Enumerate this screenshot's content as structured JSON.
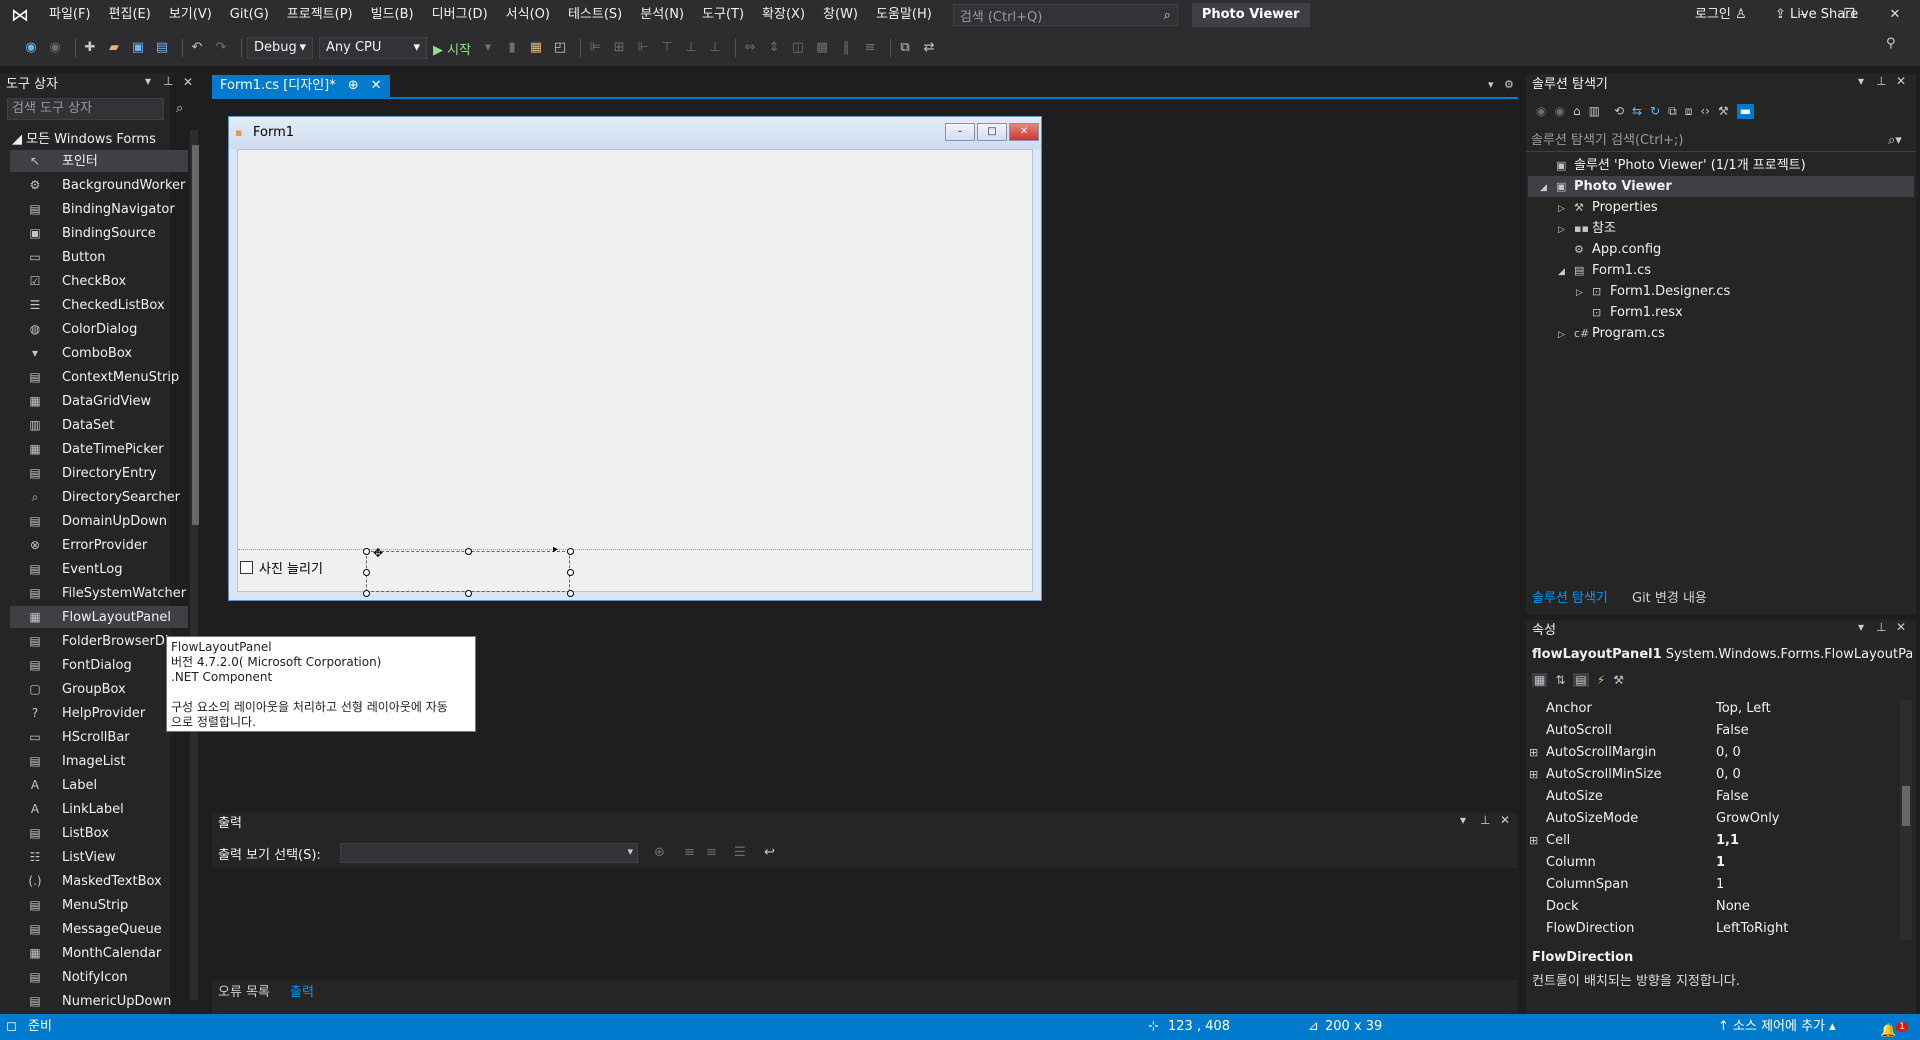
{
  "menu": [
    "파일(F)",
    "편집(E)",
    "보기(V)",
    "Git(G)",
    "프로젝트(P)",
    "빌드(B)",
    "디버그(D)",
    "서식(O)",
    "테스트(S)",
    "분석(N)",
    "도구(T)",
    "확장(X)",
    "창(W)",
    "도움말(H)"
  ],
  "search_placeholder": "검색 (Ctrl+Q)",
  "app_title": "Photo Viewer",
  "login": "로그인",
  "toolbar": {
    "config": "Debug",
    "platform": "Any CPU",
    "start": "▶ 시작",
    "live_share": "Live Share"
  },
  "toolbox": {
    "title": "도구 상자",
    "search": "검색 도구 상자",
    "group": "◢ 모든 Windows Forms",
    "items": [
      "포인터",
      "BackgroundWorker",
      "BindingNavigator",
      "BindingSource",
      "Button",
      "CheckBox",
      "CheckedListBox",
      "ColorDialog",
      "ComboBox",
      "ContextMenuStrip",
      "DataGridView",
      "DataSet",
      "DateTimePicker",
      "DirectoryEntry",
      "DirectorySearcher",
      "DomainUpDown",
      "ErrorProvider",
      "EventLog",
      "FileSystemWatcher",
      "FlowLayoutPanel",
      "FolderBrowserDi",
      "FontDialog",
      "GroupBox",
      "HelpProvider",
      "HScrollBar",
      "ImageList",
      "Label",
      "LinkLabel",
      "ListBox",
      "ListView",
      "MaskedTextBox",
      "MenuStrip",
      "MessageQueue",
      "MonthCalendar",
      "NotifyIcon",
      "NumericUpDown"
    ]
  },
  "doc_tab": {
    "label": "Form1.cs [디자인]*",
    "pin": "⊕",
    "close": "✕"
  },
  "form": {
    "title": "Form1",
    "checkbox_label": "사진 늘리기"
  },
  "tooltip": {
    "line1": "FlowLayoutPanel",
    "line2": "버전 4.7.2.0( Microsoft Corporation)",
    "line3": ".NET Component",
    "line4": "구성 요소의 레이아웃을 처리하고 선형 레이아웃에 자동",
    "line5": "으로 정렬합니다."
  },
  "output": {
    "title": "출력",
    "label": "출력 보기 선택(S):",
    "tabs": [
      "오류 목록",
      "출력"
    ]
  },
  "solution_explorer": {
    "title": "솔루션 탐색기",
    "search": "솔루션 탐색기 검색(Ctrl+;)",
    "nodes": [
      "솔루션 'Photo Viewer' (1/1개 프로젝트)",
      "Photo Viewer",
      "Properties",
      "참조",
      "App.config",
      "Form1.cs",
      "Form1.Designer.cs",
      "Form1.resx",
      "Program.cs"
    ],
    "tabs": [
      "솔루션 탐색기",
      "Git 변경 내용"
    ]
  },
  "properties": {
    "title": "속성",
    "object_name": "flowLayoutPanel1",
    "object_type": "System.Windows.Forms.FlowLayoutPan",
    "rows": [
      {
        "name": "Anchor",
        "value": "Top, Left"
      },
      {
        "name": "AutoScroll",
        "value": "False"
      },
      {
        "name": "AutoScrollMargin",
        "value": "0, 0"
      },
      {
        "name": "AutoScrollMinSize",
        "value": "0, 0"
      },
      {
        "name": "AutoSize",
        "value": "False"
      },
      {
        "name": "AutoSizeMode",
        "value": "GrowOnly"
      },
      {
        "name": "Cell",
        "value": "1,1"
      },
      {
        "name": "Column",
        "value": "1"
      },
      {
        "name": "ColumnSpan",
        "value": "1"
      },
      {
        "name": "Dock",
        "value": "None"
      },
      {
        "name": "FlowDirection",
        "value": "LeftToRight"
      }
    ],
    "desc_title": "FlowDirection",
    "desc": "컨트롤이 배치되는 방향을 지정합니다."
  },
  "status": {
    "ready": "준비",
    "position": "123 , 408",
    "size": "200 x 39",
    "source_control": "↑ 소스 제어에 추가 ▴",
    "notifications": "1"
  },
  "colors": {
    "accent": "#007acc",
    "background": "#1e1e1e",
    "panel": "#252526"
  }
}
